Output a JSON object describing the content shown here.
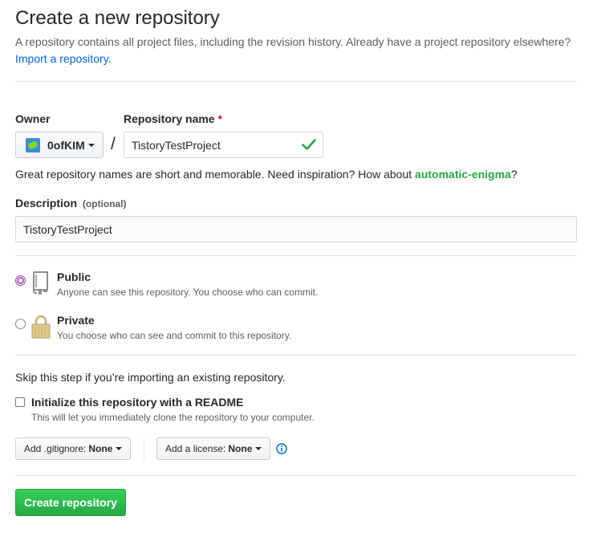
{
  "header": {
    "title": "Create a new repository",
    "subtitle": "A repository contains all project files, including the revision history. Already have a project repository elsewhere?",
    "import_link": "Import a repository."
  },
  "owner": {
    "label": "Owner",
    "value": "0ofKIM",
    "avatar_icon": "user-avatar"
  },
  "repository_name": {
    "label": "Repository name",
    "required_marker": "*",
    "value": "TistoryTestProject",
    "valid_icon": "check-icon"
  },
  "separator": "/",
  "name_hint": {
    "text": "Great repository names are short and memorable. Need inspiration? How about",
    "suggestion": "automatic-enigma",
    "suffix": "?"
  },
  "description": {
    "label": "Description",
    "optional": "(optional)",
    "value": "TistoryTestProject"
  },
  "visibility": {
    "selected": "public",
    "options": [
      {
        "id": "public",
        "title": "Public",
        "note": "Anyone can see this repository. You choose who can commit.",
        "icon": "repo-book-icon"
      },
      {
        "id": "private",
        "title": "Private",
        "note": "You choose who can see and commit to this repository.",
        "icon": "lock-icon"
      }
    ]
  },
  "init": {
    "skip_note": "Skip this step if you’re importing an existing repository.",
    "readme_label": "Initialize this repository with a README",
    "readme_note": "This will let you immediately clone the repository to your computer.",
    "readme_checked": false
  },
  "gitignore": {
    "label": "Add .gitignore:",
    "value": "None"
  },
  "license": {
    "label": "Add a license:",
    "value": "None",
    "info_icon": "info-icon"
  },
  "submit": {
    "label": "Create repository"
  },
  "colors": {
    "link": "#0366d6",
    "suggestion": "#28a745",
    "primary_button": "#2ea44f",
    "required": "#cb2431",
    "radio_selected": "#b15bb5"
  }
}
